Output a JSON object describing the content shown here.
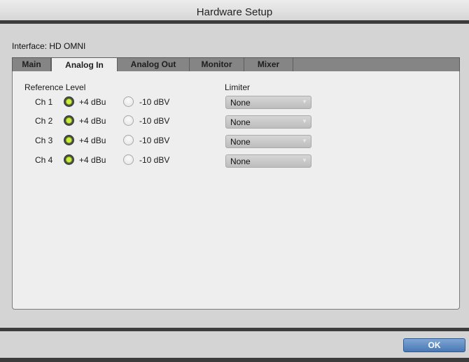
{
  "window": {
    "title": "Hardware Setup"
  },
  "interface": {
    "label": "Interface:",
    "value": "HD OMNI"
  },
  "tabs": [
    {
      "label": "Main",
      "active": false
    },
    {
      "label": "Analog In",
      "active": true
    },
    {
      "label": "Analog Out",
      "active": false
    },
    {
      "label": "Monitor",
      "active": false
    },
    {
      "label": "Mixer",
      "active": false
    }
  ],
  "panel": {
    "reference_level_label": "Reference Level",
    "limiter_label": "Limiter",
    "option_plus4": "+4 dBu",
    "option_minus10": "-10 dBV",
    "channels": [
      {
        "name": "Ch 1",
        "selected": "+4 dBu",
        "limiter": "None"
      },
      {
        "name": "Ch 2",
        "selected": "+4 dBu",
        "limiter": "None"
      },
      {
        "name": "Ch 3",
        "selected": "+4 dBu",
        "limiter": "None"
      },
      {
        "name": "Ch 4",
        "selected": "+4 dBu",
        "limiter": "None"
      }
    ]
  },
  "footer": {
    "ok_label": "OK"
  },
  "colors": {
    "accent": "#4f7fbf",
    "radio_on": "#b6e02a",
    "tab_bar": "#858585"
  }
}
